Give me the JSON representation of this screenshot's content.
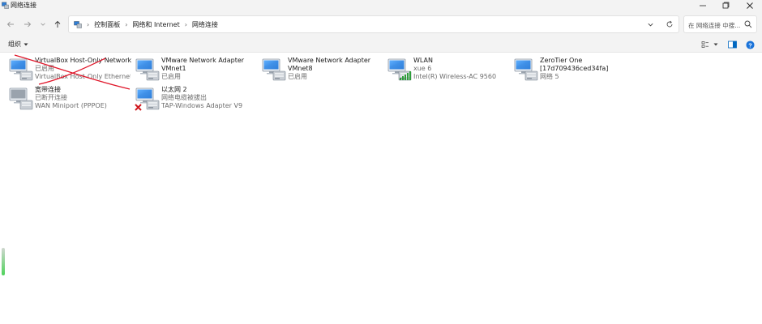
{
  "window": {
    "title": "网络连接",
    "buttons": {
      "minimize": "─",
      "maximize": "▢",
      "close": "✕"
    }
  },
  "nav": {
    "breadcrumbs": [
      "控制面板",
      "网络和 Internet",
      "网络连接"
    ],
    "search_placeholder": "在 网络连接 中搜..."
  },
  "toolbar": {
    "organize_label": "组织"
  },
  "adapters": [
    {
      "name": "VirtualBox Host-Only Network",
      "status": "已启用",
      "device": "VirtualBox Host-Only Ethernet ...",
      "icon": "ethernet-adapter",
      "crossed_out": true
    },
    {
      "name": "VMware Network Adapter",
      "name2": "VMnet1",
      "status": "已启用",
      "icon": "ethernet-adapter"
    },
    {
      "name": "VMware Network Adapter",
      "name2": "VMnet8",
      "status": "已启用",
      "icon": "ethernet-adapter"
    },
    {
      "name": "WLAN",
      "status": "xue 6",
      "device": "Intel(R) Wireless-AC 9560",
      "icon": "wifi-adapter"
    },
    {
      "name": "ZeroTier One",
      "name2": "[17d709436ced34fa]",
      "status": "网络 5",
      "icon": "ethernet-adapter"
    },
    {
      "name": "宽带连接",
      "status": "已断开连接",
      "device": "WAN Miniport (PPPOE)",
      "icon": "broadband-adapter"
    },
    {
      "name": "以太网 2",
      "status": "网络电缆被拔出",
      "device": "TAP-Windows Adapter V9",
      "icon": "ethernet-adapter-disconnected"
    }
  ],
  "colors": {
    "accent": "#0067c0",
    "annotation": "#e0182b",
    "titlebar": "#f3f3f3"
  }
}
